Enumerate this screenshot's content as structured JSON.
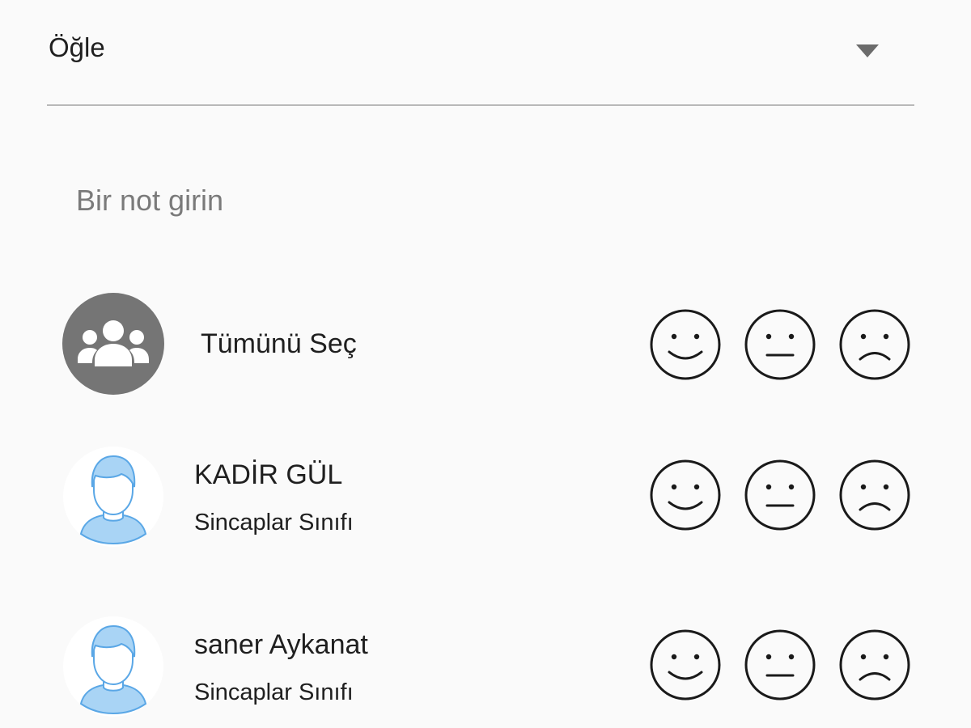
{
  "dropdown": {
    "selected_value": "Öğle",
    "icon": "arrow-drop-down-icon"
  },
  "note": {
    "placeholder": "Bir not girin",
    "value": ""
  },
  "select_all": {
    "label": "Tümünü Seç",
    "icon": "group-icon"
  },
  "students": [
    {
      "name": "KADİR GÜL",
      "class": "Sincaplar Sınıfı",
      "avatar": "student-avatar-icon"
    },
    {
      "name": "saner Aykanat",
      "class": "Sincaplar Sınıfı",
      "avatar": "student-avatar-icon"
    }
  ],
  "mood_icons": [
    "happy-face-icon",
    "neutral-face-icon",
    "sad-face-icon"
  ],
  "colors": {
    "background": "#fafafa",
    "group_avatar": "#757575",
    "student_avatar": "#a9d4f5",
    "face_stroke": "#1a1a1a"
  }
}
